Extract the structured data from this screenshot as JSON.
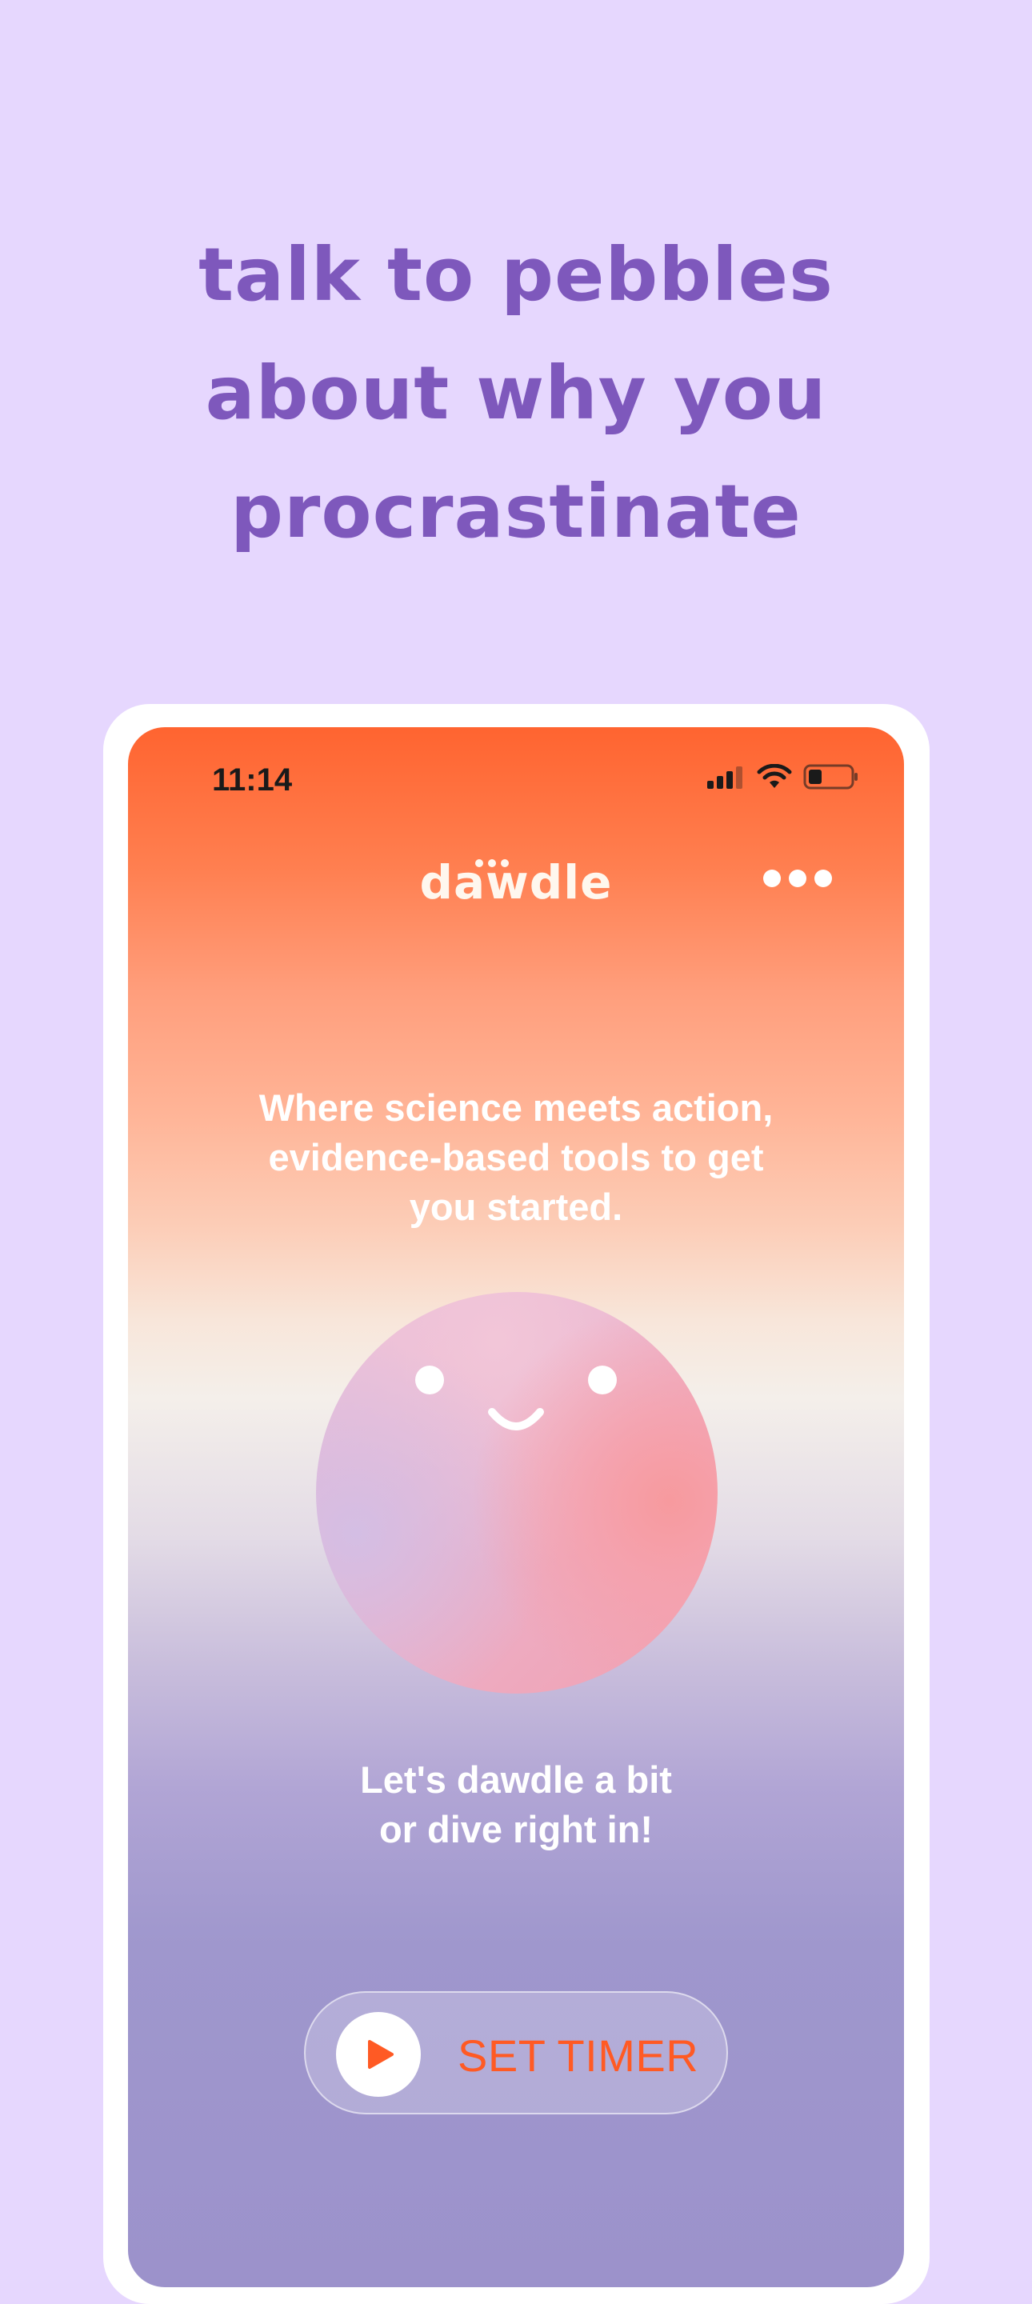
{
  "headline": {
    "lines": [
      "talk to pebbles",
      "about why you",
      "procrastinate"
    ]
  },
  "status_bar": {
    "time": "11:14",
    "icons": [
      "cellular-signal-icon",
      "wifi-icon",
      "battery-icon"
    ]
  },
  "app": {
    "logo_text": "dawdle",
    "more_icon": "more-dots-icon"
  },
  "main": {
    "tagline_lines": [
      "Where science meets action,",
      "evidence-based tools to get",
      "you started."
    ],
    "mascot": "pebbles-face",
    "mascot_text_lines": [
      "Let's dawdle a bit",
      "or dive right in!"
    ]
  },
  "timer_button": {
    "icon": "play-icon",
    "label": "SET TIMER"
  },
  "colors": {
    "background": "#E6D7FE",
    "headline": "#7E58BC",
    "accent": "#FF5A24",
    "frame": "#FFFFFF"
  }
}
